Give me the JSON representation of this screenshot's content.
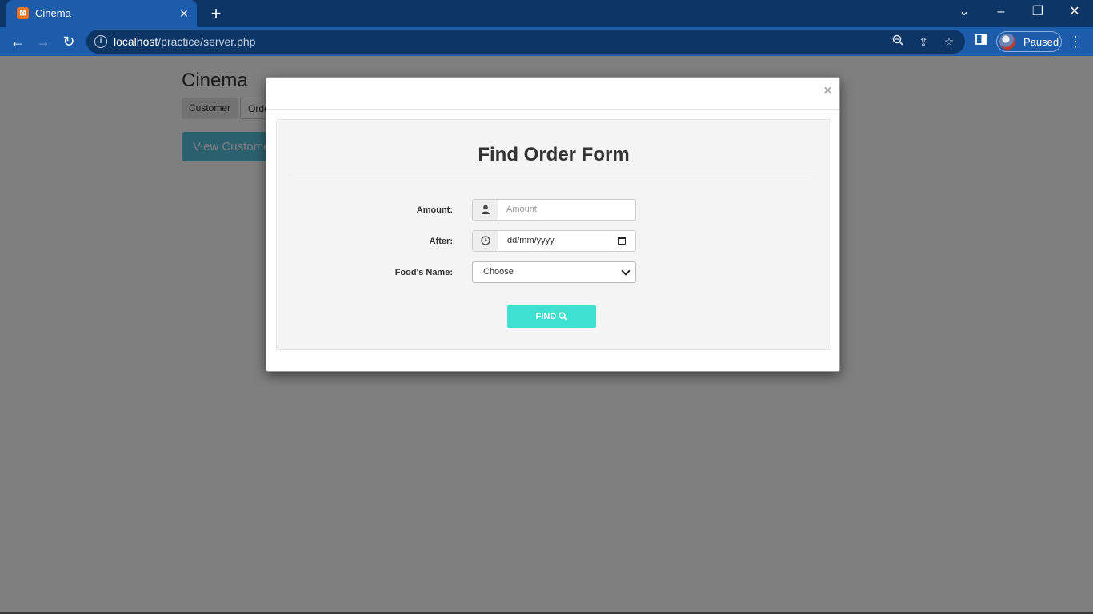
{
  "browser": {
    "tab_title": "Cinema",
    "tab_favicon": "xampp-icon",
    "url_host": "localhost",
    "url_path": "/practice/server.php",
    "profile_status": "Paused"
  },
  "page": {
    "title": "Cinema",
    "nav": [
      "Customer",
      "Order"
    ],
    "view_button": "View Customer"
  },
  "modal": {
    "close": "×",
    "form_title": "Find Order Form",
    "fields": {
      "amount_label": "Amount:",
      "amount_placeholder": "Amount",
      "after_label": "After:",
      "after_value": "dd/mm/yyyy",
      "food_label": "Food's Name:",
      "food_selected": "Choose"
    },
    "submit_label": "FIND"
  },
  "colors": {
    "chrome_dark": "#0d3566",
    "chrome": "#1c5cab",
    "find_button": "#40e0d0",
    "view_button": "#5bc0de"
  }
}
